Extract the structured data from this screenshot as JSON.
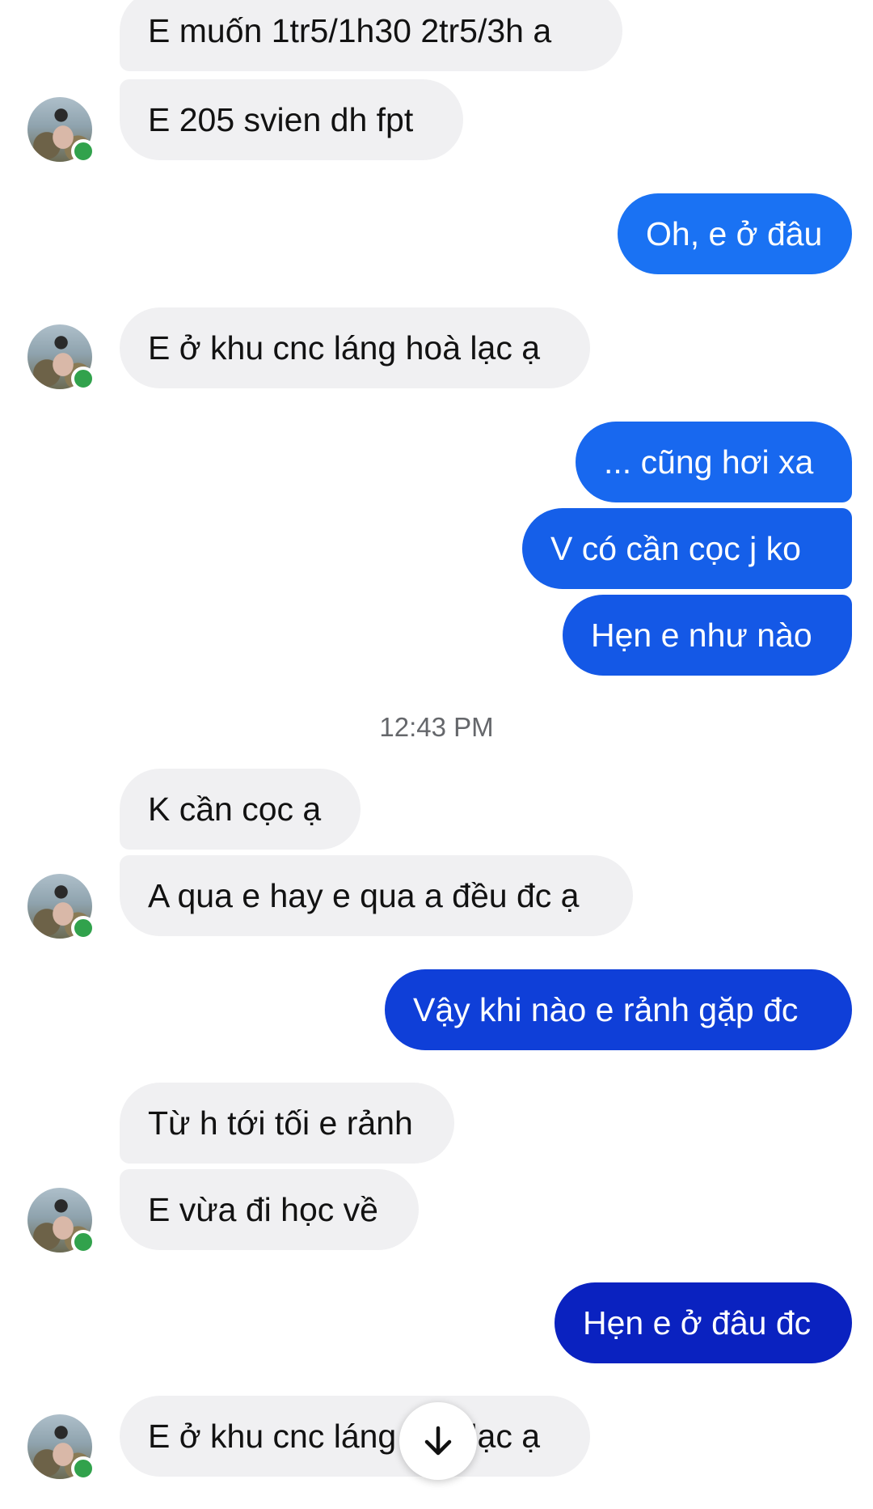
{
  "messages": [
    {
      "dir": "in",
      "text": "E muốn 1tr5/1h30 2tr5/3h a"
    },
    {
      "dir": "in",
      "text": "E 205 svien dh fpt"
    },
    {
      "dir": "out",
      "text": "Oh, e ở đâu"
    },
    {
      "dir": "in",
      "text": "E ở khu cnc láng hoà lạc ạ"
    },
    {
      "dir": "out",
      "text": "... cũng hơi xa"
    },
    {
      "dir": "out",
      "text": "V có cần cọc j ko"
    },
    {
      "dir": "out",
      "text": "Hẹn e như nào"
    },
    {
      "dir": "in",
      "text": "K cần cọc ạ"
    },
    {
      "dir": "in",
      "text": "A qua e hay e qua a đều đc ạ"
    },
    {
      "dir": "out",
      "text": "Vậy khi nào e rảnh gặp đc"
    },
    {
      "dir": "in",
      "text": "Từ h tới tối e rảnh"
    },
    {
      "dir": "in",
      "text": "E vừa đi học về"
    },
    {
      "dir": "out",
      "text": "Hẹn e ở đâu đc"
    },
    {
      "dir": "in",
      "text": "E ở khu cnc láng hoà lạc ạ"
    }
  ],
  "timestamp": "12:43 PM",
  "colors": {
    "incoming_bubble": "#f0f0f2",
    "outgoing_top": "#1877f2",
    "outgoing_bottom": "#0a1ab8",
    "online_dot": "#31a24c"
  },
  "icons": {
    "scroll_down": "arrow-down-icon",
    "avatar": "contact-avatar",
    "presence": "online-status-dot"
  }
}
